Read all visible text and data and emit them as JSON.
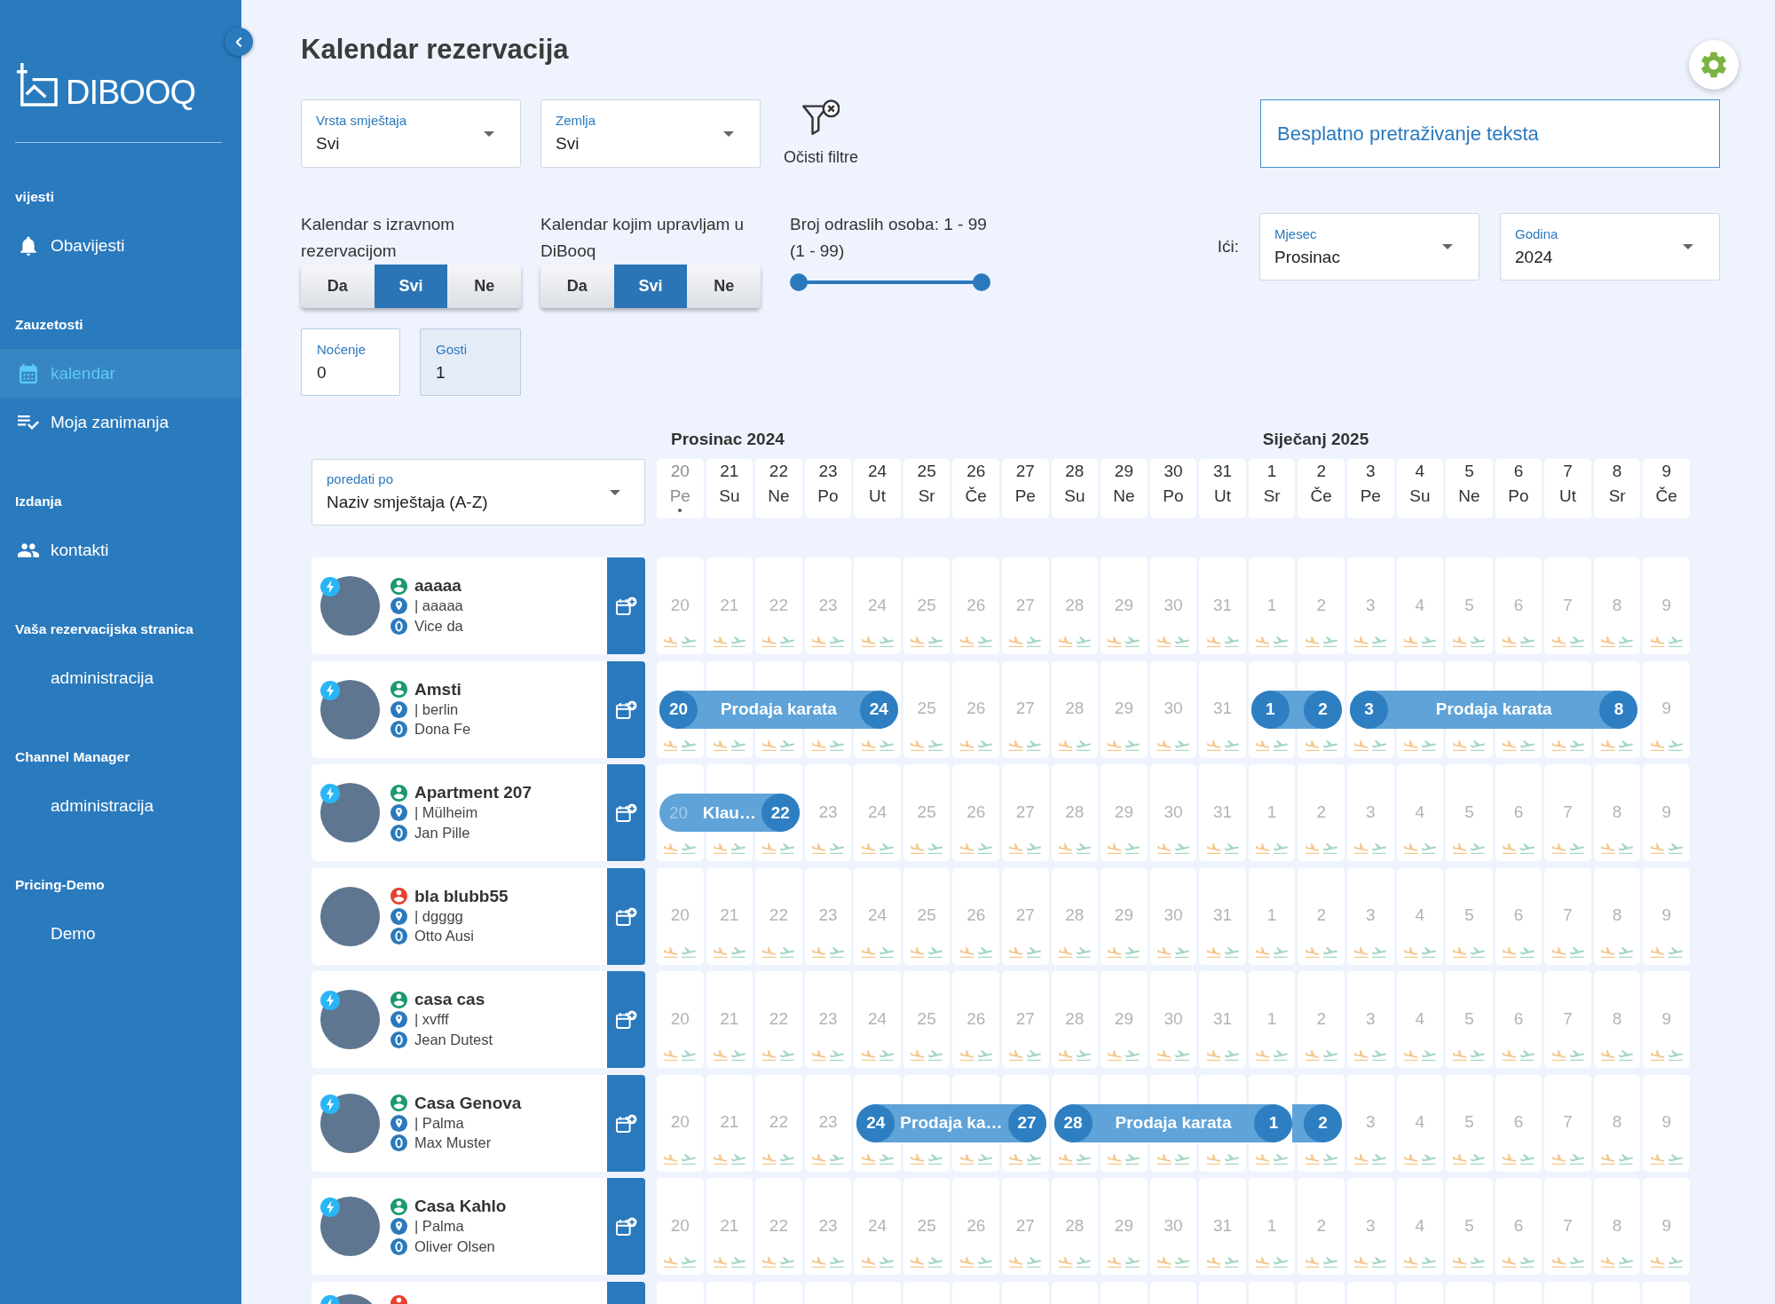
{
  "sidebar": {
    "logo": "DIBOOQ",
    "sections": [
      {
        "title": "vijesti",
        "items": [
          {
            "kind": "notifications",
            "label": "Obavijesti",
            "selected": false
          }
        ]
      },
      {
        "title": "Zauzetosti",
        "items": [
          {
            "kind": "calendar",
            "label": "kalendar",
            "selected": true
          },
          {
            "kind": "tasks",
            "label": "Moja zanimanja",
            "selected": false
          }
        ]
      },
      {
        "title": "Izdanja",
        "items": [
          {
            "kind": "contacts",
            "label": "kontakti",
            "selected": false
          }
        ]
      },
      {
        "title": "Vaša rezervacijska stranica",
        "items": [
          {
            "kind": "page",
            "label": "administracija",
            "selected": false
          }
        ]
      },
      {
        "title": "Channel Manager",
        "items": [
          {
            "kind": "page",
            "label": "administracija",
            "selected": false
          }
        ]
      },
      {
        "title": "Pricing-Demo",
        "items": [
          {
            "kind": "page",
            "label": "Demo",
            "selected": false
          }
        ]
      }
    ]
  },
  "header": {
    "title": "Kalendar rezervacija"
  },
  "filters": {
    "dropdowns": [
      {
        "label": "Vrsta smještaja",
        "value": "Svi"
      },
      {
        "label": "Zemlja",
        "value": "Svi"
      }
    ],
    "clear": "Očisti filtre",
    "search": {
      "placeholder": "Besplatno pretraživanje teksta"
    }
  },
  "toggles": [
    {
      "label": "Kalendar s izravnom rezervacijom",
      "options": [
        {
          "label": "Da",
          "selected": false
        },
        {
          "label": "Svi",
          "selected": true
        },
        {
          "label": "Ne",
          "selected": false
        }
      ]
    },
    {
      "label": "Kalendar kojim upravljam u DiBooq",
      "options": [
        {
          "label": "Da",
          "selected": false
        },
        {
          "label": "Svi",
          "selected": true
        },
        {
          "label": "Ne",
          "selected": false
        }
      ]
    }
  ],
  "adults": {
    "label": "Broj odraslih osoba: 1 - 99",
    "range": "(1 - 99)",
    "thumbs": [
      {
        "level": 0
      },
      {
        "level": 1
      }
    ]
  },
  "go_to": {
    "label": "Ići:",
    "month": {
      "label": "Mjesec",
      "value": "Prosinac"
    },
    "year": {
      "label": "Godina",
      "value": "2024"
    }
  },
  "fields": [
    {
      "label": "Noćenje",
      "value": "0",
      "disabled": false
    },
    {
      "label": "Gosti",
      "value": "1",
      "disabled": true
    }
  ],
  "calendar": {
    "sort": {
      "label": "poredati po",
      "value": "Naziv smještaja (A-Z)"
    },
    "months": [
      {
        "label": "Prosinac 2024",
        "days": [
          {
            "day": "20",
            "weekday": "Pe",
            "today": true
          },
          {
            "day": "21",
            "weekday": "Su",
            "today": false
          },
          {
            "day": "22",
            "weekday": "Ne",
            "today": false
          },
          {
            "day": "23",
            "weekday": "Po",
            "today": false
          },
          {
            "day": "24",
            "weekday": "Ut",
            "today": false
          },
          {
            "day": "25",
            "weekday": "Sr",
            "today": false
          },
          {
            "day": "26",
            "weekday": "Če",
            "today": false
          },
          {
            "day": "27",
            "weekday": "Pe",
            "today": false
          },
          {
            "day": "28",
            "weekday": "Su",
            "today": false
          },
          {
            "day": "29",
            "weekday": "Ne",
            "today": false
          },
          {
            "day": "30",
            "weekday": "Po",
            "today": false
          },
          {
            "day": "31",
            "weekday": "Ut",
            "today": false
          }
        ]
      },
      {
        "label": "Siječanj 2025",
        "days": [
          {
            "day": "1",
            "weekday": "Sr",
            "today": false
          },
          {
            "day": "2",
            "weekday": "Če",
            "today": false
          },
          {
            "day": "3",
            "weekday": "Pe",
            "today": false
          },
          {
            "day": "4",
            "weekday": "Su",
            "today": false
          },
          {
            "day": "5",
            "weekday": "Ne",
            "today": false
          },
          {
            "day": "6",
            "weekday": "Po",
            "today": false
          },
          {
            "day": "7",
            "weekday": "Ut",
            "today": false
          },
          {
            "day": "8",
            "weekday": "Sr",
            "today": false
          },
          {
            "day": "9",
            "weekday": "Če",
            "today": false
          }
        ]
      }
    ],
    "rows": [
      {
        "name": "aaaaa",
        "location": "| aaaaa",
        "host": "Vice da",
        "color": "#1b9a6c",
        "instant": true,
        "cells": [
          {
            "kind": "day",
            "day": "20"
          },
          {
            "kind": "day",
            "day": "21"
          },
          {
            "kind": "day",
            "day": "22"
          },
          {
            "kind": "day",
            "day": "23"
          },
          {
            "kind": "day",
            "day": "24"
          },
          {
            "kind": "day",
            "day": "25"
          },
          {
            "kind": "day",
            "day": "26"
          },
          {
            "kind": "day",
            "day": "27"
          },
          {
            "kind": "day",
            "day": "28"
          },
          {
            "kind": "day",
            "day": "29"
          },
          {
            "kind": "day",
            "day": "30"
          },
          {
            "kind": "day",
            "day": "31"
          },
          {
            "kind": "day",
            "day": "1"
          },
          {
            "kind": "day",
            "day": "2"
          },
          {
            "kind": "day",
            "day": "3"
          },
          {
            "kind": "day",
            "day": "4"
          },
          {
            "kind": "day",
            "day": "5"
          },
          {
            "kind": "day",
            "day": "6"
          },
          {
            "kind": "day",
            "day": "7"
          },
          {
            "kind": "day",
            "day": "8"
          },
          {
            "kind": "day",
            "day": "9"
          }
        ],
        "bookings": []
      },
      {
        "name": "Amsti",
        "location": "| berlin",
        "host": "Dona Fe",
        "color": "#1b9a6c",
        "instant": true,
        "cells": [
          {
            "kind": "checkin"
          },
          {
            "kind": "stay"
          },
          {
            "kind": "stay"
          },
          {
            "kind": "stay"
          },
          {
            "kind": "checkout"
          },
          {
            "kind": "day",
            "day": "25"
          },
          {
            "kind": "day",
            "day": "26"
          },
          {
            "kind": "day",
            "day": "27"
          },
          {
            "kind": "day",
            "day": "28"
          },
          {
            "kind": "day",
            "day": "29"
          },
          {
            "kind": "day",
            "day": "30"
          },
          {
            "kind": "day",
            "day": "31"
          },
          {
            "kind": "checkin"
          },
          {
            "kind": "checkout"
          },
          {
            "kind": "checkin"
          },
          {
            "kind": "stay"
          },
          {
            "kind": "stay"
          },
          {
            "kind": "stay"
          },
          {
            "kind": "stay"
          },
          {
            "kind": "checkout"
          },
          {
            "kind": "day",
            "day": "9"
          }
        ],
        "bookings": [
          {
            "start": "20",
            "label": "Prodaja karata",
            "end": "24",
            "open_start": false
          },
          {
            "start": "1",
            "end": "2",
            "open_start": false
          },
          {
            "start": "3",
            "label": "Prodaja karata",
            "end": "8",
            "open_start": false
          }
        ]
      },
      {
        "name": "Apartment 207",
        "location": "| Mülheim",
        "host": "Jan Pille",
        "color": "#1b9a6c",
        "instant": true,
        "cells": [
          {
            "kind": "checkin"
          },
          {
            "kind": "stay"
          },
          {
            "kind": "checkout"
          },
          {
            "kind": "day",
            "day": "23"
          },
          {
            "kind": "day",
            "day": "24"
          },
          {
            "kind": "day",
            "day": "25"
          },
          {
            "kind": "day",
            "day": "26"
          },
          {
            "kind": "day",
            "day": "27"
          },
          {
            "kind": "day",
            "day": "28"
          },
          {
            "kind": "day",
            "day": "29"
          },
          {
            "kind": "day",
            "day": "30"
          },
          {
            "kind": "day",
            "day": "31"
          },
          {
            "kind": "day",
            "day": "1"
          },
          {
            "kind": "day",
            "day": "2"
          },
          {
            "kind": "day",
            "day": "3"
          },
          {
            "kind": "day",
            "day": "4"
          },
          {
            "kind": "day",
            "day": "5"
          },
          {
            "kind": "day",
            "day": "6"
          },
          {
            "kind": "day",
            "day": "7"
          },
          {
            "kind": "day",
            "day": "8"
          },
          {
            "kind": "day",
            "day": "9"
          }
        ],
        "bookings": [
          {
            "start": "20",
            "label": "Klau…",
            "end": "22",
            "open_start": true
          }
        ]
      },
      {
        "name": "bla blubb55",
        "location": "| dgggg",
        "host": "Otto Ausi",
        "color": "#e8402f",
        "instant": false,
        "cells": [
          {
            "kind": "day",
            "day": "20"
          },
          {
            "kind": "day",
            "day": "21"
          },
          {
            "kind": "day",
            "day": "22"
          },
          {
            "kind": "day",
            "day": "23"
          },
          {
            "kind": "day",
            "day": "24"
          },
          {
            "kind": "day",
            "day": "25"
          },
          {
            "kind": "day",
            "day": "26"
          },
          {
            "kind": "day",
            "day": "27"
          },
          {
            "kind": "day",
            "day": "28"
          },
          {
            "kind": "day",
            "day": "29"
          },
          {
            "kind": "day",
            "day": "30"
          },
          {
            "kind": "day",
            "day": "31"
          },
          {
            "kind": "day",
            "day": "1"
          },
          {
            "kind": "day",
            "day": "2"
          },
          {
            "kind": "day",
            "day": "3"
          },
          {
            "kind": "day",
            "day": "4"
          },
          {
            "kind": "day",
            "day": "5"
          },
          {
            "kind": "day",
            "day": "6"
          },
          {
            "kind": "day",
            "day": "7"
          },
          {
            "kind": "day",
            "day": "8"
          },
          {
            "kind": "day",
            "day": "9"
          }
        ],
        "bookings": []
      },
      {
        "name": "casa cas",
        "location": "| xvfff",
        "host": "Jean Dutest",
        "color": "#1b9a6c",
        "instant": true,
        "cells": [
          {
            "kind": "day",
            "day": "20"
          },
          {
            "kind": "day",
            "day": "21"
          },
          {
            "kind": "day",
            "day": "22"
          },
          {
            "kind": "day",
            "day": "23"
          },
          {
            "kind": "day",
            "day": "24"
          },
          {
            "kind": "day",
            "day": "25"
          },
          {
            "kind": "day",
            "day": "26"
          },
          {
            "kind": "day",
            "day": "27"
          },
          {
            "kind": "day",
            "day": "28"
          },
          {
            "kind": "day",
            "day": "29"
          },
          {
            "kind": "day",
            "day": "30"
          },
          {
            "kind": "day",
            "day": "31"
          },
          {
            "kind": "day",
            "day": "1"
          },
          {
            "kind": "day",
            "day": "2"
          },
          {
            "kind": "day",
            "day": "3"
          },
          {
            "kind": "day",
            "day": "4"
          },
          {
            "kind": "day",
            "day": "5"
          },
          {
            "kind": "day",
            "day": "6"
          },
          {
            "kind": "day",
            "day": "7"
          },
          {
            "kind": "day",
            "day": "8"
          },
          {
            "kind": "day",
            "day": "9"
          }
        ],
        "bookings": []
      },
      {
        "name": "Casa Genova",
        "location": "| Palma",
        "host": "Max Muster",
        "color": "#1b9a6c",
        "instant": true,
        "cells": [
          {
            "kind": "day",
            "day": "20"
          },
          {
            "kind": "day",
            "day": "21"
          },
          {
            "kind": "day",
            "day": "22"
          },
          {
            "kind": "day",
            "day": "23"
          },
          {
            "kind": "checkin"
          },
          {
            "kind": "stay"
          },
          {
            "kind": "stay"
          },
          {
            "kind": "checkout"
          },
          {
            "kind": "checkin"
          },
          {
            "kind": "stay"
          },
          {
            "kind": "stay"
          },
          {
            "kind": "stay"
          },
          {
            "kind": "checkout"
          },
          {
            "kind": "single"
          },
          {
            "kind": "day",
            "day": "3"
          },
          {
            "kind": "day",
            "day": "4"
          },
          {
            "kind": "day",
            "day": "5"
          },
          {
            "kind": "day",
            "day": "6"
          },
          {
            "kind": "day",
            "day": "7"
          },
          {
            "kind": "day",
            "day": "8"
          },
          {
            "kind": "day",
            "day": "9"
          }
        ],
        "bookings": [
          {
            "start": "24",
            "label": "Prodaja ka…",
            "end": "27",
            "open_start": false
          },
          {
            "start": "28",
            "label": "Prodaja karata",
            "end": "1",
            "open_start": false
          },
          {
            "end": "2",
            "open_start": true
          }
        ]
      },
      {
        "name": "Casa Kahlo",
        "location": "| Palma",
        "host": "Oliver Olsen",
        "color": "#1b9a6c",
        "instant": true,
        "cells": [
          {
            "kind": "day",
            "day": "20"
          },
          {
            "kind": "day",
            "day": "21"
          },
          {
            "kind": "day",
            "day": "22"
          },
          {
            "kind": "day",
            "day": "23"
          },
          {
            "kind": "day",
            "day": "24"
          },
          {
            "kind": "day",
            "day": "25"
          },
          {
            "kind": "day",
            "day": "26"
          },
          {
            "kind": "day",
            "day": "27"
          },
          {
            "kind": "day",
            "day": "28"
          },
          {
            "kind": "day",
            "day": "29"
          },
          {
            "kind": "day",
            "day": "30"
          },
          {
            "kind": "day",
            "day": "31"
          },
          {
            "kind": "day",
            "day": "1"
          },
          {
            "kind": "day",
            "day": "2"
          },
          {
            "kind": "day",
            "day": "3"
          },
          {
            "kind": "day",
            "day": "4"
          },
          {
            "kind": "day",
            "day": "5"
          },
          {
            "kind": "day",
            "day": "6"
          },
          {
            "kind": "day",
            "day": "7"
          },
          {
            "kind": "day",
            "day": "8"
          },
          {
            "kind": "day",
            "day": "9"
          }
        ],
        "bookings": []
      },
      {
        "color": "#e8402f",
        "instant": true
      }
    ]
  }
}
